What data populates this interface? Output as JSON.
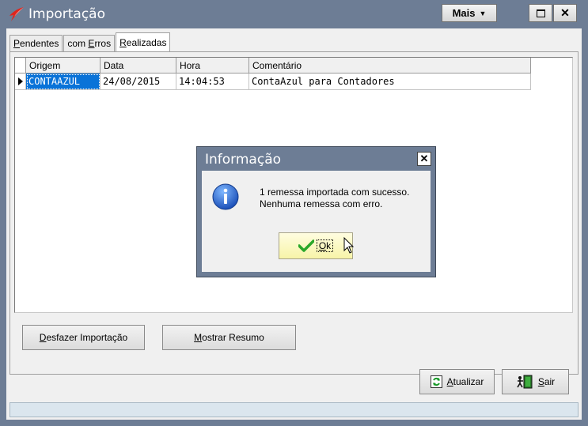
{
  "window": {
    "title": "Importação",
    "mais_label": "Mais",
    "colors": {
      "frame": "#6d7d95",
      "client": "#f0f0f0",
      "selection": "#0a73d8",
      "ok_button": "#f7f4a8"
    }
  },
  "tabs": [
    {
      "pre": "",
      "key": "P",
      "post": "endentes",
      "active": false
    },
    {
      "pre": "com ",
      "key": "E",
      "post": "rros",
      "active": false
    },
    {
      "pre": "",
      "key": "R",
      "post": "ealizadas",
      "active": true
    }
  ],
  "grid": {
    "columns": [
      "Origem",
      "Data",
      "Hora",
      "Comentário"
    ],
    "rows": [
      {
        "origem": "CONTAAZUL",
        "data": "24/08/2015",
        "hora": "14:04:53",
        "comentario": "ContaAzul para Contadores"
      }
    ]
  },
  "buttons": {
    "desfazer": {
      "key": "D",
      "rest": "esfazer Importação"
    },
    "mostrar": {
      "key": "M",
      "rest": "ostrar Resumo"
    },
    "atualizar": {
      "key": "A",
      "rest": "tualizar"
    },
    "sair": {
      "key": "S",
      "rest": "air"
    }
  },
  "dialog": {
    "title": "Informação",
    "line1": "1 remessa importada com sucesso.",
    "line2": "Nenhuma remessa com erro.",
    "ok": {
      "key": "O",
      "rest": "k"
    }
  },
  "icons": [
    "app-logo-icon",
    "chevron-down-icon",
    "maximize-icon",
    "close-icon",
    "row-indicator-icon",
    "refresh-icon",
    "exit-door-icon",
    "info-icon",
    "checkmark-icon",
    "mouse-cursor-icon"
  ]
}
